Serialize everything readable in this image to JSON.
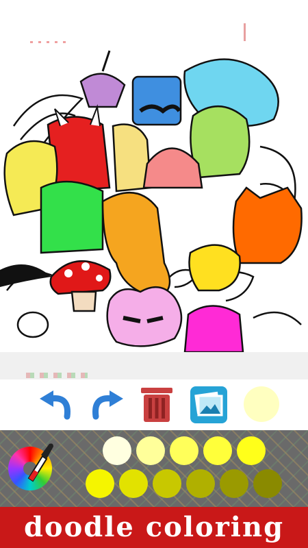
{
  "app": {
    "banner_title": "doodle coloring"
  },
  "toolbar": {
    "undo_icon": "undo-arrow-icon",
    "redo_icon": "redo-arrow-icon",
    "trash_icon": "trash-can-icon",
    "gallery_icon": "photo-gallery-icon",
    "current_color": "#ffffc0"
  },
  "palette": {
    "picker_icon": "color-wheel-eyedropper-icon",
    "row1": [
      "#ffffe0",
      "#ffff9a",
      "#ffff5a",
      "#ffff3a",
      "#ffff1a"
    ],
    "row2": [
      "#f5f500",
      "#e2e200",
      "#c8c800",
      "#b0b000",
      "#9a9a00",
      "#8a8a00"
    ]
  },
  "colors": {
    "banner_red": "#c91818",
    "palette_bg": "#6a6a6a",
    "undo_blue": "#2f7fd6",
    "trash_red": "#c94040"
  }
}
